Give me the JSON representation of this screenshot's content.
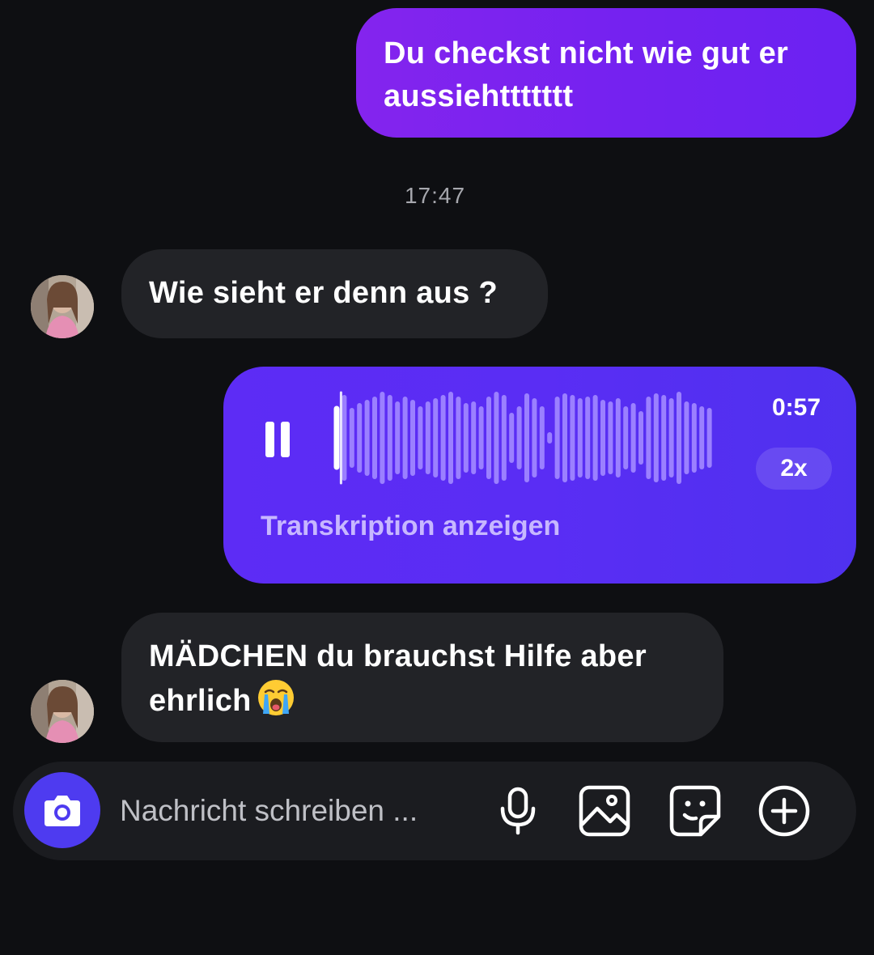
{
  "messages": {
    "sent_1": "Du checkst nicht wie gut er aussiehttttttt",
    "timestamp": "17:47",
    "received_1": "Wie sieht er denn aus ?",
    "voice": {
      "duration": "0:57",
      "speed": "2x",
      "transcript_link": "Transkription anzeigen",
      "progress": 0.02
    },
    "received_2": "MÄDCHEN du brauchst Hilfe aber ehrlich",
    "received_2_emoji": "loudly-crying-face-emoji"
  },
  "composer": {
    "placeholder": "Nachricht schreiben ...",
    "icons": [
      "camera-icon",
      "microphone-icon",
      "image-icon",
      "sticker-icon",
      "plus-circle-icon"
    ]
  },
  "colors": {
    "background": "#0e0f12",
    "sent_bubble": "#7a22ef",
    "voice_bubble": "#5a2df4",
    "received_bubble": "#222327",
    "camera_button": "#4e3bf0"
  }
}
